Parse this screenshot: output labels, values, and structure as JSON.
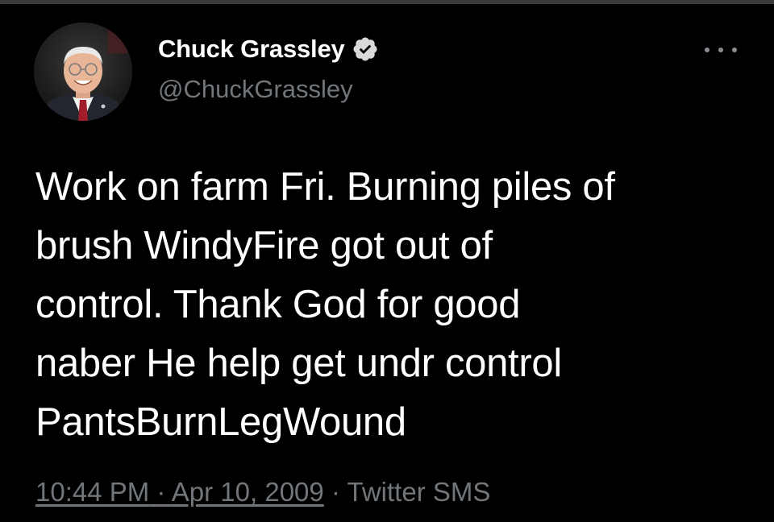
{
  "tweet": {
    "author": {
      "display_name": "Chuck Grassley",
      "handle": "@ChuckGrassley",
      "verified": true,
      "verified_icon": "verified-badge-icon",
      "avatar_icon": "profile-photo"
    },
    "text": "Work on farm Fri. Burning piles of\nbrush WindyFire got out of\ncontrol. Thank God for good\nnaber He help get undr control\nPantsBurnLegWound",
    "time": "10:44 PM",
    "separator": "·",
    "date": "Apr 10, 2009",
    "source": "Twitter SMS",
    "more_icon": "more-options-icon"
  },
  "colors": {
    "background": "#000000",
    "text": "#ffffff",
    "secondary": "#71767b"
  }
}
